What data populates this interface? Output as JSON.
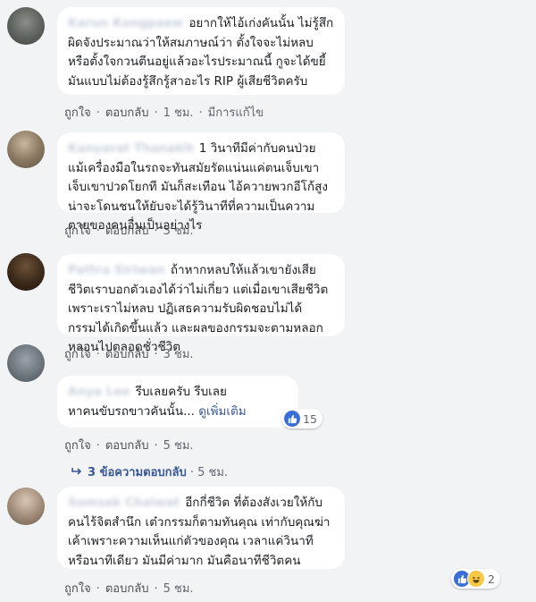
{
  "comments": [
    {
      "text": "อยากให้ไอ้เก่งคันนั้น ไม่รู้สึกผิดจังประมาณว่าให้สมภาษณ์ว่า ตั้งใจจะไม่หลบ หรือตั้งใจกวนตีนอยู่แล้วอะไรประมาณนี้ กูจะได้ขยี้มันแบบไม่ต้องรู้สึกรู้สาอะไร RIP ผู้เสียชีวิตครับ",
      "like": "ถูกใจ",
      "reply": "ตอบกลับ",
      "time": "1 ชม.",
      "edited": "มีการแก้ไข"
    },
    {
      "text": "1 วินาทีมีค่ากับคนป่วย แม้เครื่องมือในรถจะทันสมัยรัดแน่นแค่ตนเจ็บเขาเจ็บเขาปวดโยกที มันก็สะเทือน ไอ้ควายพวกอีโก้สูงน่าจะโดนชนให้ยับจะได้รู้วินาทีที่ความเป็นความตายของคนอื่นเป็นอย่างไร",
      "like": "ถูกใจ",
      "reply": "ตอบกลับ",
      "time": "3 ชม."
    },
    {
      "text": "ถ้าหากหลบให้แล้วเขายังเสียชีวิตเราบอกตัวเองได้ว่าไม่เกี่ยว แต่เมื่อเขาเสียชีวิตเพราะเราไม่หลบ ปฏิเสธความรับผิดชอบไม่ได้ กรรมได้เกิดขึ้นแล้ว และผลของกรรมจะตามหลอกหลอนไปตลอดชั่วชีวิต",
      "like": "ถูกใจ",
      "reply": "ตอบกลับ",
      "time": "3 ชม."
    },
    {
      "text": "รีบเลยครับ รีบเลย",
      "text2": "หาคนขับรถขาวคันนั้น...",
      "see_more": "ดูเพิ่มเติม",
      "reactions": "15",
      "like": "ถูกใจ",
      "reply": "ตอบกลับ",
      "time": "5 ชม."
    },
    {
      "text": "อีกกี่ชีวิต ที่ต้องสังเวยให้กับคนไร้จิตสำนึก เต๋วกรรมก็ตามทันคุณ เท่ากับคุณฆ่าเค้าเพราะความเห็นแก่ตัวของคุณ เวลาแค่วินาที หรือนาทีเดียว มันมีค่ามาก มันคือนาทีชีวิตคน",
      "reactions": "2",
      "like": "ถูกใจ",
      "reply": "ตอบกลับ",
      "time": "5 ชม."
    }
  ],
  "replies_link": {
    "label": "3 ข้อความตอบกลับ",
    "time": "5 ชม."
  },
  "colors": {
    "background": "#f2f3f5",
    "link": "#385898",
    "like_blue": "#3b6fd8",
    "haha_yellow": "#f7c945"
  }
}
